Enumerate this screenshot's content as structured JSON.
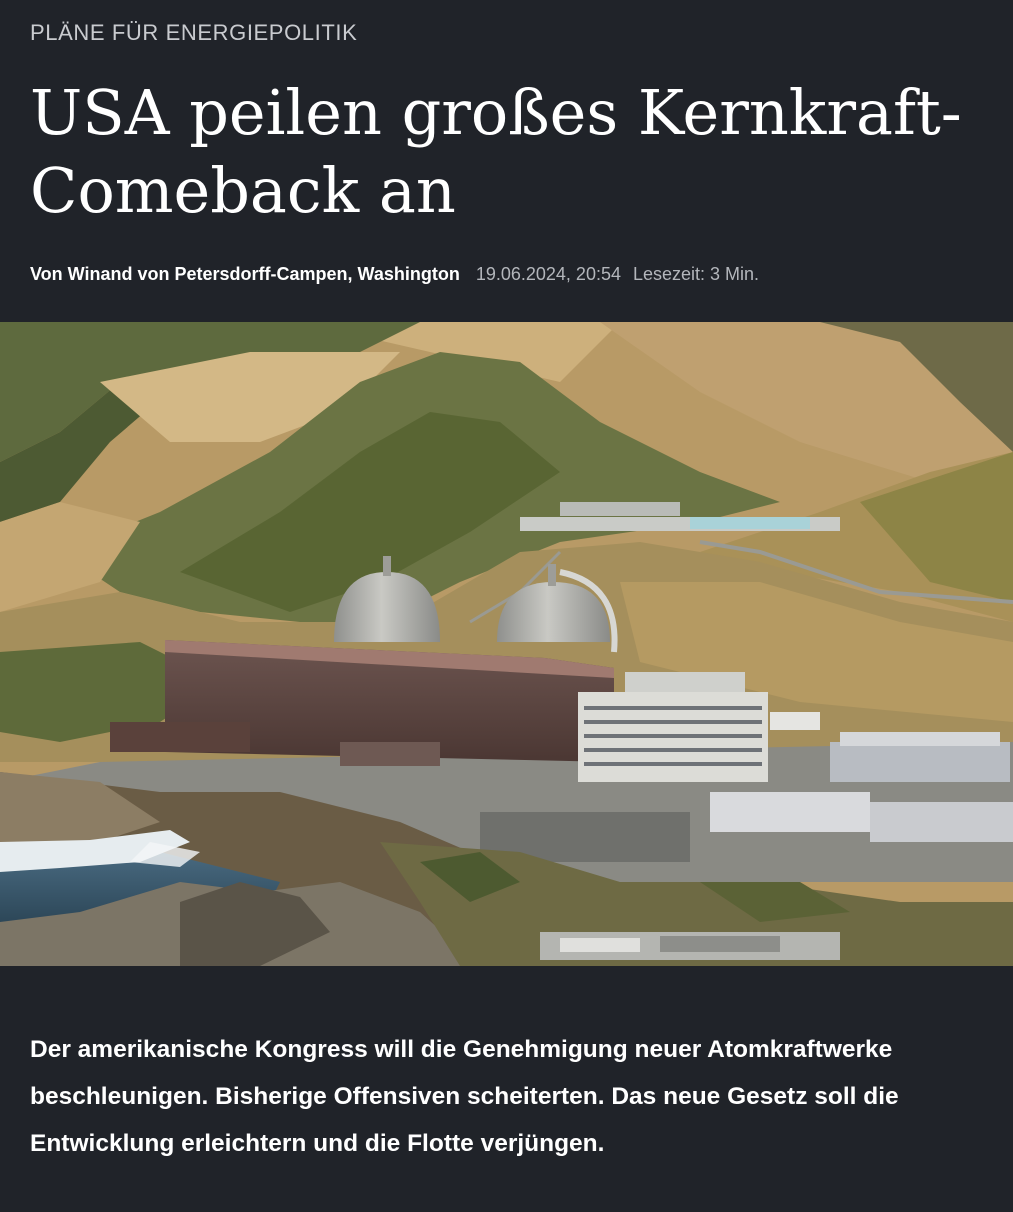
{
  "article": {
    "kicker": "PLÄNE FÜR ENERGIEPOLITIK",
    "headline": "USA peilen großes Kernkraft-Comeback an",
    "author": "Von Winand von Petersdorff-Campen, Washington",
    "date": "19.06.2024, 20:54",
    "reading_time": "Lesezeit: 3 Min.",
    "teaser": "Der amerikanische Kongress will die Genehmigung neuer Atomkraftwerke beschleunigen. Bisherige Offensiven scheiterten. Das neue Gesetz soll die Entwicklung erleichtern und die Flotte verjüngen."
  },
  "image": {
    "subject": "nuclear-power-plant-coastal-hills"
  },
  "colors": {
    "background": "#202329",
    "text": "#ffffff",
    "muted": "#b3b6bb"
  }
}
